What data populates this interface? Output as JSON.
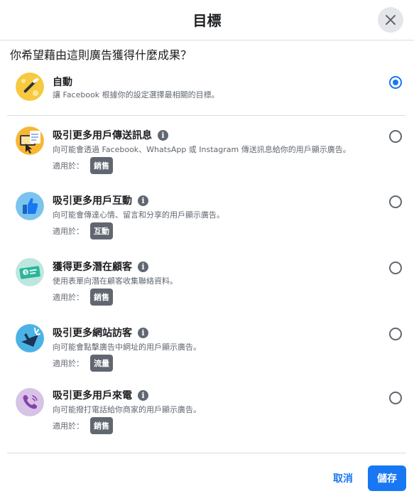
{
  "dialog": {
    "title": "目標",
    "question": "你希望藉由這則廣告獲得什麼成果？",
    "applies_label": "適用於：",
    "options": [
      {
        "title": "自動",
        "description": "讓 Facebook 根據你的設定選擇最相關的目標。",
        "badge": "",
        "selected": true,
        "icon": "magic-wand-icon"
      },
      {
        "title": "吸引更多用戶傳送訊息",
        "description": "向可能會透過 Facebook、WhatsApp 或 Instagram 傳送訊息給你的用戶顯示廣告。",
        "badge": "銷售",
        "selected": false,
        "icon": "message-icon"
      },
      {
        "title": "吸引更多用戶互動",
        "description": "向可能會傳達心情、留言和分享的用戶顯示廣告。",
        "badge": "互動",
        "selected": false,
        "icon": "thumbs-up-icon"
      },
      {
        "title": "獲得更多潛在顧客",
        "description": "使用表單向潛在顧客收集聯絡資料。",
        "badge": "銷售",
        "selected": false,
        "icon": "contact-card-icon"
      },
      {
        "title": "吸引更多網站訪客",
        "description": "向可能會點擊廣告中網址的用戶顯示廣告。",
        "badge": "流量",
        "selected": false,
        "icon": "cursor-click-icon"
      },
      {
        "title": "吸引更多用戶來電",
        "description": "向可能撥打電話給你商家的用戶顯示廣告。",
        "badge": "銷售",
        "selected": false,
        "icon": "phone-icon"
      }
    ]
  },
  "footer": {
    "cancel_label": "取消",
    "save_label": "儲存"
  },
  "colors": {
    "primary": "#1877f2",
    "badge": "#606770",
    "text": "#1c1e21",
    "secondary_text": "#606770"
  }
}
